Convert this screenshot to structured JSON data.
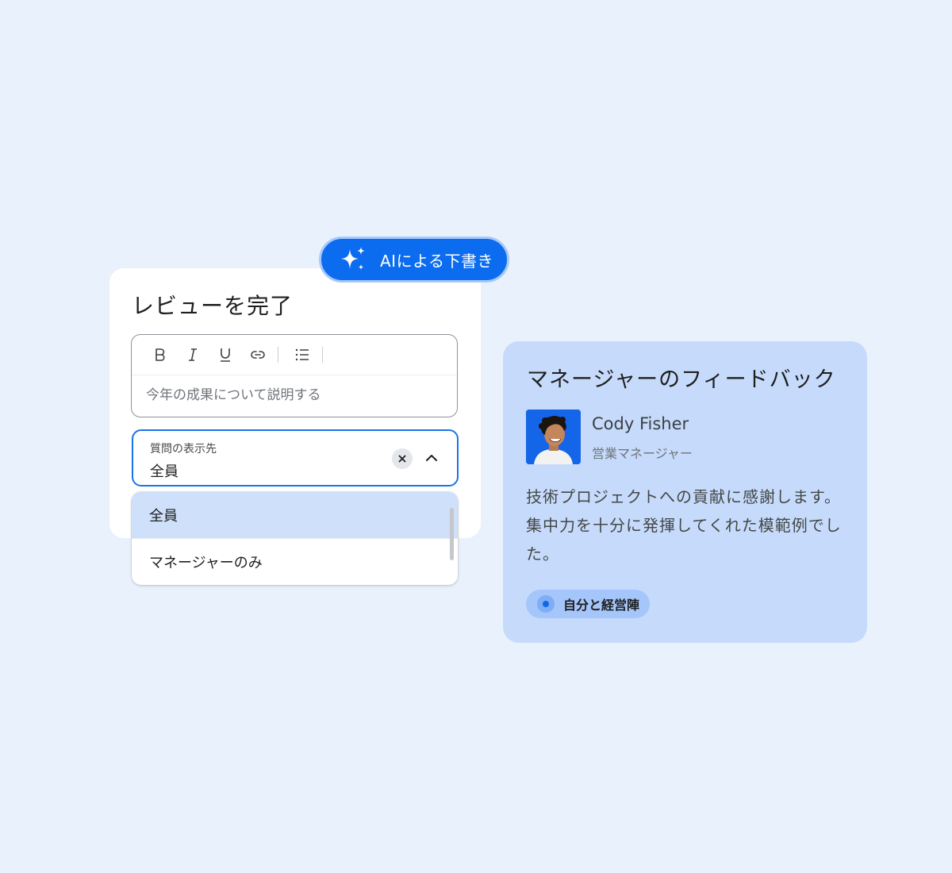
{
  "review": {
    "title": "レビューを完了",
    "ai_button_label": "AIによる下書き",
    "editor": {
      "placeholder": "今年の成果について説明する",
      "toolbar": [
        "bold-icon",
        "italic-icon",
        "underline-icon",
        "link-icon",
        "bulleted-list-icon"
      ]
    },
    "visibility_select": {
      "label": "質問の表示先",
      "value": "全員",
      "options": [
        "全員",
        "マネージャーのみ"
      ],
      "selected_index": 0
    }
  },
  "feedback": {
    "title": "マネージャーのフィードバック",
    "person": {
      "name": "Cody Fisher",
      "role": "営業マネージャー"
    },
    "body": "技術プロジェクトへの貢献に感謝します。集中力を十分に発揮してくれた模範例でした。",
    "visibility_chip": "自分と経営陣"
  },
  "colors": {
    "background": "#e9f1fd",
    "accent": "#0b6cf0",
    "feedback_card": "#c6dbfb",
    "selected_option": "#cfe0fb"
  }
}
